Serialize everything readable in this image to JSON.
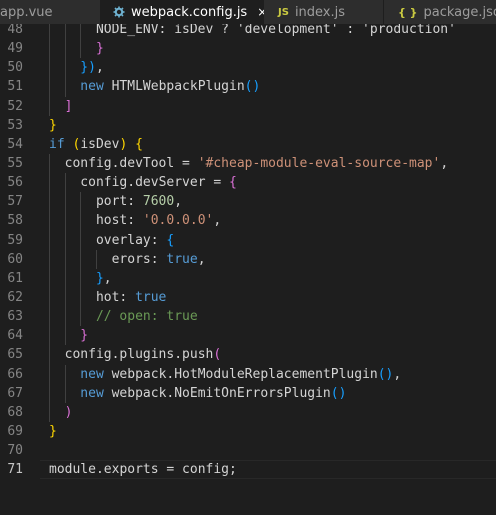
{
  "tabs": [
    {
      "label": "app.vue",
      "icon": "vue-file-icon",
      "active": false
    },
    {
      "label": "webpack.config.js",
      "icon": "settings-file-icon",
      "active": true,
      "close": "×"
    },
    {
      "label": "index.js",
      "icon": "js-file-icon",
      "icon_text": "JS",
      "active": false
    },
    {
      "label": "package.json",
      "icon": "json-file-icon",
      "icon_text": "{ }",
      "active": false
    }
  ],
  "colors": {
    "background": "#1e1e1e",
    "tab_bar": "#252526",
    "keyword": "#569cd6",
    "string": "#ce9178",
    "number": "#b5cea8",
    "comment": "#6a9955",
    "bracket_gold": "#ffd700",
    "bracket_purple": "#da70d6",
    "bracket_blue": "#179fff"
  },
  "editor": {
    "current_line": 71,
    "lines": [
      {
        "n": "48",
        "indent": 3,
        "tokens": [
          {
            "t": "NODE_ENV: isDev ? 'development' : 'production'",
            "c": "t-plain"
          }
        ]
      },
      {
        "n": "49",
        "indent": 3,
        "tokens": [
          {
            "t": "}",
            "c": "t-br2"
          }
        ]
      },
      {
        "n": "50",
        "indent": 2,
        "tokens": [
          {
            "t": "})",
            "c": "t-br3"
          },
          {
            "t": ",",
            "c": "t-plain"
          }
        ]
      },
      {
        "n": "51",
        "indent": 2,
        "tokens": [
          {
            "t": "new ",
            "c": "t-kw"
          },
          {
            "t": "HTMLWebpackPlugin",
            "c": "t-plain"
          },
          {
            "t": "()",
            "c": "t-br3"
          }
        ]
      },
      {
        "n": "52",
        "indent": 1,
        "tokens": [
          {
            "t": "]",
            "c": "t-br2"
          }
        ]
      },
      {
        "n": "53",
        "indent": 0,
        "tokens": [
          {
            "t": "}",
            "c": "t-br1"
          }
        ]
      },
      {
        "n": "54",
        "indent": 0,
        "tokens": [
          {
            "t": "if ",
            "c": "t-kw"
          },
          {
            "t": "(",
            "c": "t-br1"
          },
          {
            "t": "isDev",
            "c": "t-plain"
          },
          {
            "t": ")",
            "c": "t-br1"
          },
          {
            "t": " ",
            "c": "t-plain"
          },
          {
            "t": "{",
            "c": "t-br1"
          }
        ]
      },
      {
        "n": "55",
        "indent": 1,
        "tokens": [
          {
            "t": "config.devTool = ",
            "c": "t-plain"
          },
          {
            "t": "'#cheap-module-eval-source-map'",
            "c": "t-str"
          },
          {
            "t": ",",
            "c": "t-plain"
          }
        ]
      },
      {
        "n": "56",
        "indent": 2,
        "tokens": [
          {
            "t": "config.devServer = ",
            "c": "t-plain"
          },
          {
            "t": "{",
            "c": "t-br2"
          }
        ]
      },
      {
        "n": "57",
        "indent": 3,
        "tokens": [
          {
            "t": "port: ",
            "c": "t-plain"
          },
          {
            "t": "7600",
            "c": "t-num"
          },
          {
            "t": ",",
            "c": "t-plain"
          }
        ]
      },
      {
        "n": "58",
        "indent": 3,
        "tokens": [
          {
            "t": "host: ",
            "c": "t-plain"
          },
          {
            "t": "'0.0.0.0'",
            "c": "t-str"
          },
          {
            "t": ",",
            "c": "t-plain"
          }
        ]
      },
      {
        "n": "59",
        "indent": 3,
        "tokens": [
          {
            "t": "overlay: ",
            "c": "t-plain"
          },
          {
            "t": "{",
            "c": "t-br3"
          }
        ]
      },
      {
        "n": "60",
        "indent": 4,
        "tokens": [
          {
            "t": "erors: ",
            "c": "t-plain"
          },
          {
            "t": "true",
            "c": "t-kw"
          },
          {
            "t": ",",
            "c": "t-plain"
          }
        ]
      },
      {
        "n": "61",
        "indent": 3,
        "tokens": [
          {
            "t": "}",
            "c": "t-br3"
          },
          {
            "t": ",",
            "c": "t-plain"
          }
        ]
      },
      {
        "n": "62",
        "indent": 3,
        "tokens": [
          {
            "t": "hot: ",
            "c": "t-plain"
          },
          {
            "t": "true",
            "c": "t-kw"
          }
        ]
      },
      {
        "n": "63",
        "indent": 3,
        "tokens": [
          {
            "t": "// open: true",
            "c": "t-cmt"
          }
        ]
      },
      {
        "n": "64",
        "indent": 2,
        "tokens": [
          {
            "t": "}",
            "c": "t-br2"
          }
        ]
      },
      {
        "n": "65",
        "indent": 1,
        "tokens": [
          {
            "t": "config.plugins.push",
            "c": "t-plain"
          },
          {
            "t": "(",
            "c": "t-br2"
          }
        ]
      },
      {
        "n": "66",
        "indent": 2,
        "tokens": [
          {
            "t": "new ",
            "c": "t-kw"
          },
          {
            "t": "webpack.HotModuleReplacementPlugin",
            "c": "t-plain"
          },
          {
            "t": "()",
            "c": "t-br3"
          },
          {
            "t": ",",
            "c": "t-plain"
          }
        ]
      },
      {
        "n": "67",
        "indent": 2,
        "tokens": [
          {
            "t": "new ",
            "c": "t-kw"
          },
          {
            "t": "webpack.NoEmitOnErrorsPlugin",
            "c": "t-plain"
          },
          {
            "t": "()",
            "c": "t-br3"
          }
        ]
      },
      {
        "n": "68",
        "indent": 1,
        "tokens": [
          {
            "t": ")",
            "c": "t-br2"
          }
        ]
      },
      {
        "n": "69",
        "indent": 0,
        "tokens": [
          {
            "t": "}",
            "c": "t-br1"
          }
        ]
      },
      {
        "n": "70",
        "indent": 0,
        "tokens": []
      },
      {
        "n": "71",
        "indent": 0,
        "tokens": [
          {
            "t": "module.exports = config;",
            "c": "t-plain"
          }
        ]
      }
    ]
  }
}
